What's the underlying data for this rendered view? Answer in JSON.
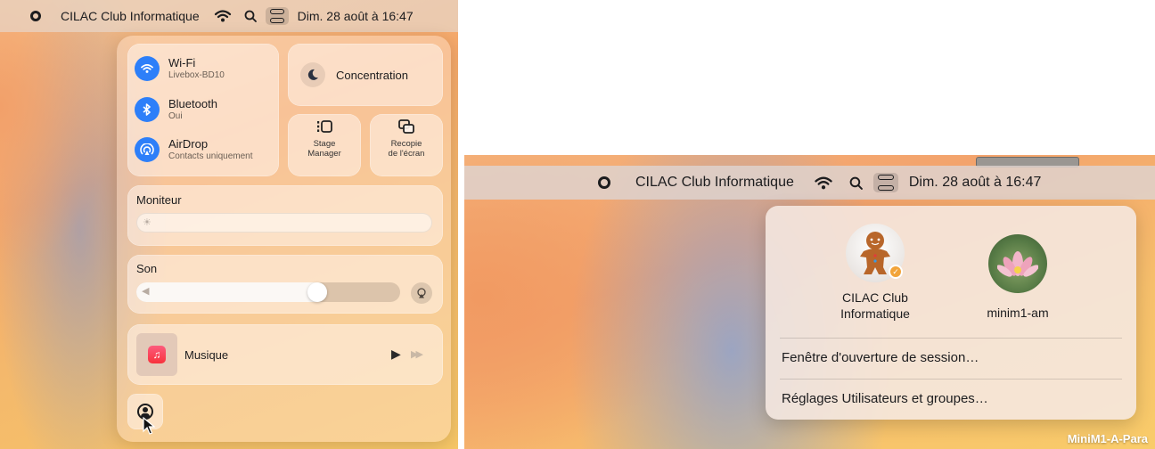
{
  "menubar": {
    "app_name": "CILAC Club Informatique",
    "clock": "Dim. 28 août à 16:47"
  },
  "control_center": {
    "network": [
      {
        "title": "Wi-Fi",
        "subtitle": "Livebox-BD10",
        "icon": "wifi-icon"
      },
      {
        "title": "Bluetooth",
        "subtitle": "Oui",
        "icon": "bluetooth-icon"
      },
      {
        "title": "AirDrop",
        "subtitle": "Contacts uniquement",
        "icon": "airdrop-icon"
      }
    ],
    "focus_label": "Concentration",
    "stage_manager_label": "Stage\nManager",
    "screen_mirroring_label": "Recopie\nde l'écran",
    "display": {
      "label": "Moniteur",
      "level": 0.0
    },
    "sound": {
      "label": "Son",
      "level": 0.7
    },
    "now_playing": {
      "label": "Musique"
    }
  },
  "user_menu": {
    "users": [
      {
        "name_line1": "CILAC Club",
        "name_line2": "Informatique",
        "avatar": "gingerbread-avatar",
        "current": true
      },
      {
        "name_line1": "minim1-am",
        "name_line2": "",
        "avatar": "lotus-avatar",
        "current": false
      }
    ],
    "items": [
      "Fenêtre d'ouverture de session…",
      "Réglages Utilisateurs et groupes…"
    ]
  },
  "desktop_label": "MiniM1-A-Para",
  "colors": {
    "accent": "#2d7ff9",
    "check_badge": "#f2a43a"
  }
}
